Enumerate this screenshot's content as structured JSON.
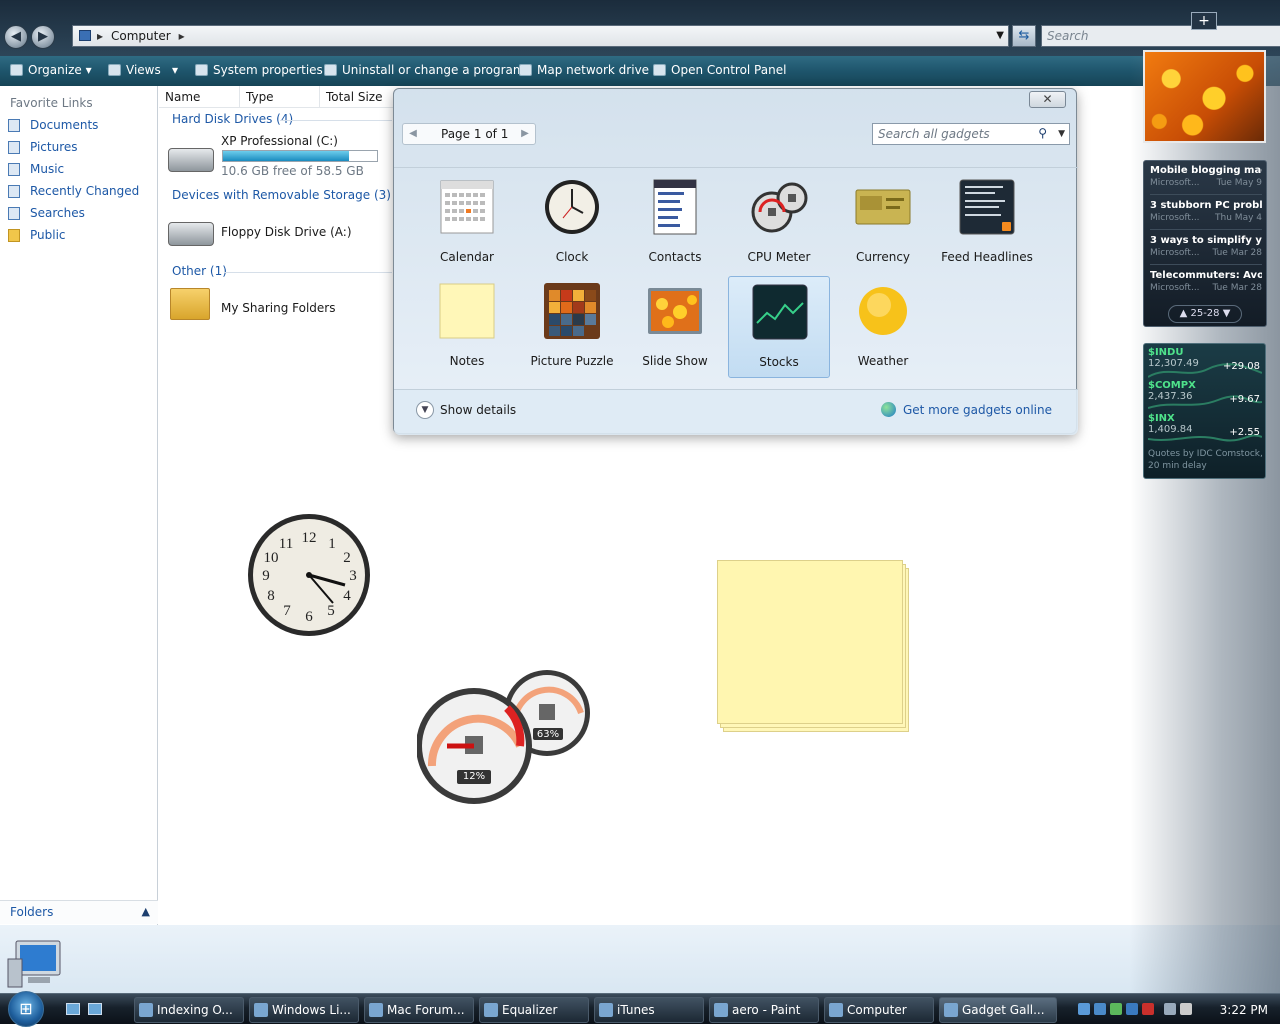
{
  "window": {
    "address": "Computer",
    "search_placeholder": "Search"
  },
  "toolbar": {
    "organize": "Organize",
    "views": "Views",
    "system_properties": "System properties",
    "uninstall": "Uninstall or change a program",
    "map_drive": "Map network drive",
    "control_panel": "Open Control Panel"
  },
  "sidebar_nav": {
    "heading": "Favorite Links",
    "items": [
      "Documents",
      "Pictures",
      "Music",
      "Recently Changed",
      "Searches",
      "Public"
    ],
    "folders": "Folders"
  },
  "columns": [
    "Name",
    "Type",
    "Total Size"
  ],
  "groups": {
    "hdd": "Hard Disk Drives (4)",
    "removable": "Devices with Removable Storage (3)",
    "other": "Other (1)"
  },
  "items": {
    "c_drive": "XP Professional (C:)",
    "c_free": "10.6 GB free of 58.5 GB",
    "c_used_fraction": 0.82,
    "floppy": "Floppy Disk Drive (A:)",
    "sharing": "My Sharing Folders"
  },
  "gallery": {
    "close": "✕",
    "page": "Page 1 of 1",
    "search_placeholder": "Search all gadgets",
    "gadgets": [
      "Calendar",
      "Clock",
      "Contacts",
      "CPU Meter",
      "Currency",
      "Feed Headlines",
      "Notes",
      "Picture Puzzle",
      "Slide Show",
      "Stocks",
      "Weather"
    ],
    "selected": "Stocks",
    "show_details": "Show details",
    "get_more": "Get more gadgets online"
  },
  "feeds": {
    "items": [
      {
        "title": "Mobile blogging mad...",
        "source": "Microsoft...",
        "date": "Tue May 9"
      },
      {
        "title": "3 stubborn PC proble...",
        "source": "Microsoft...",
        "date": "Thu May 4"
      },
      {
        "title": "3 ways to simplify y...",
        "source": "Microsoft...",
        "date": "Tue Mar 28"
      },
      {
        "title": "Telecommuters: Avo...",
        "source": "Microsoft...",
        "date": "Tue Mar 28"
      }
    ],
    "range": "25-28"
  },
  "stocks": {
    "items": [
      {
        "symbol": "$INDU",
        "price": "12,307.49",
        "change": "+29.08"
      },
      {
        "symbol": "$COMPX",
        "price": "2,437.36",
        "change": "+9.67"
      },
      {
        "symbol": "$INX",
        "price": "1,409.84",
        "change": "+2.55"
      }
    ],
    "note": "Quotes by IDC Comstock, 20 min delay"
  },
  "cpu_meter": {
    "cpu": "12%",
    "memory": "63%",
    "cpu_value": 12,
    "memory_value": 63
  },
  "taskbar": {
    "tasks": [
      "Indexing O...",
      "Windows Li...",
      "Mac Forum...",
      "Equalizer",
      "iTunes",
      "aero - Paint",
      "Computer",
      "Gadget Gall..."
    ],
    "time": "3:22 PM"
  },
  "colors": {
    "accent": "#1d58a6",
    "toolbar": "#1e556c",
    "stocks_green": "#4fe38b"
  }
}
